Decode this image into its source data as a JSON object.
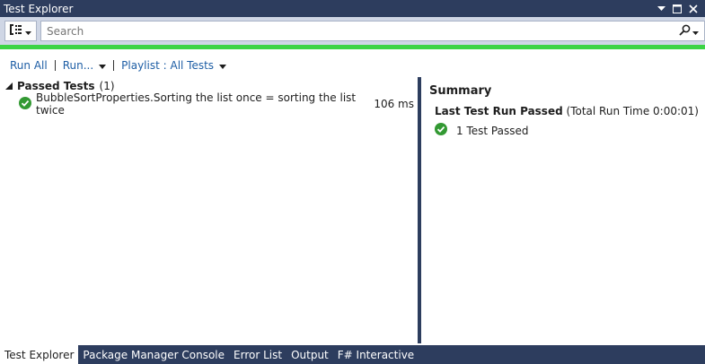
{
  "window": {
    "title": "Test Explorer"
  },
  "toolbar": {
    "search_placeholder": "Search"
  },
  "commands": {
    "run_all": "Run All",
    "run": "Run...",
    "playlist": "Playlist : All Tests"
  },
  "tests": {
    "group_label": "Passed Tests",
    "group_count": "(1)",
    "items": [
      {
        "name": "BubbleSortProperties.Sorting the list once = sorting the list twice",
        "duration": "106 ms"
      }
    ]
  },
  "summary": {
    "title": "Summary",
    "run_status": "Last Test Run Passed",
    "run_time": "(Total Run Time 0:00:01)",
    "passed_text": "1 Test Passed"
  },
  "tabs": [
    {
      "label": "Test Explorer"
    },
    {
      "label": "Package Manager Console"
    },
    {
      "label": "Error List"
    },
    {
      "label": "Output"
    },
    {
      "label": "F# Interactive"
    }
  ],
  "colors": {
    "title_bar": "#2d3d5e",
    "toolbar_bg": "#cfd6e5",
    "success_green": "#3cd444",
    "link_blue": "#1e5ea5",
    "pass_icon": "#339933"
  }
}
